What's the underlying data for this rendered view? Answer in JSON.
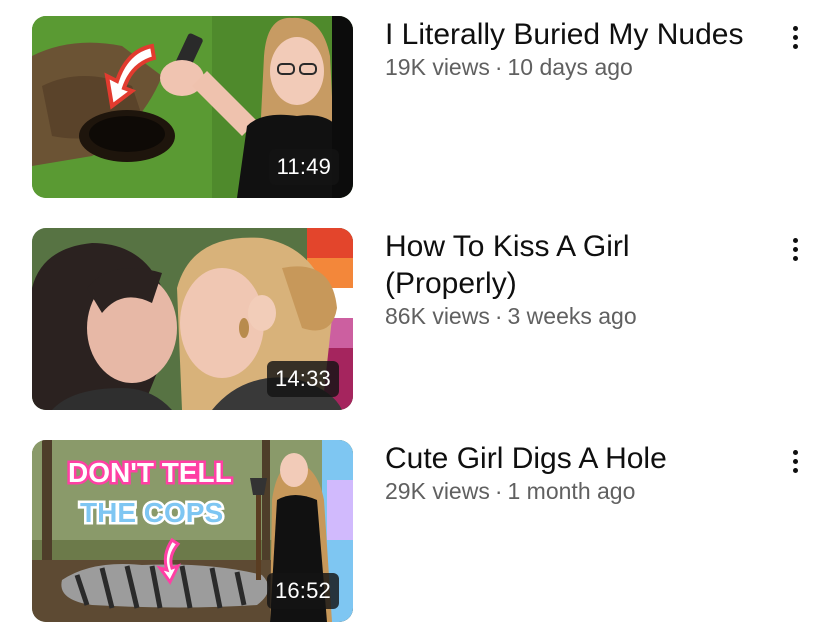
{
  "videos": [
    {
      "title": "I Literally Buried My Nudes",
      "views": "19K views",
      "separator": "·",
      "age": "10 days ago",
      "duration": "11:49",
      "thumbnail_subject": "person-holding-usb-drive-over-dug-hole-in-grass"
    },
    {
      "title": "How To Kiss A Girl (Properly)",
      "views": "86K views",
      "separator": "·",
      "age": "3 weeks ago",
      "duration": "14:33",
      "thumbnail_subject": "two-women-about-to-kiss-with-pride-flag"
    },
    {
      "title": "Cute Girl Digs A Hole",
      "views": "29K views",
      "separator": "·",
      "age": "1 month ago",
      "duration": "16:52",
      "thumbnail_subject": "woman-with-shovel-in-forest",
      "thumbnail_text": {
        "line1": "DON'T TELL",
        "line2": "THE COPS"
      }
    }
  ],
  "icons": {
    "more": "more-vertical-icon"
  },
  "colors": {
    "title": "#0f0f0f",
    "meta": "#606060",
    "duration_bg": "#141414",
    "thumb_text_pink": "#ff3fa4",
    "thumb_text_white": "#ffffff"
  }
}
